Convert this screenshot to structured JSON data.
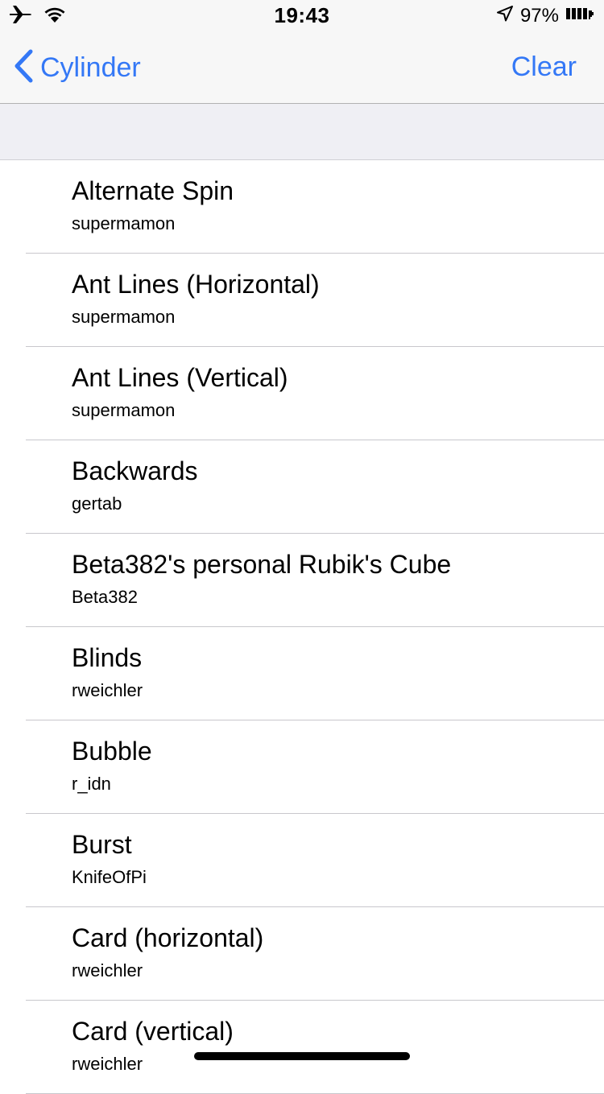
{
  "status_bar": {
    "time": "19:43",
    "battery_percent": "97%",
    "icons": [
      "airplane-icon",
      "wifi-icon",
      "location-arrow-icon",
      "battery-icon"
    ]
  },
  "nav": {
    "back_label": "Cylinder",
    "right_label": "Clear",
    "accent_color": "#3478f6"
  },
  "list": {
    "items": [
      {
        "title": "Alternate Spin",
        "author": "supermamon"
      },
      {
        "title": "Ant Lines (Horizontal)",
        "author": "supermamon"
      },
      {
        "title": "Ant Lines (Vertical)",
        "author": "supermamon"
      },
      {
        "title": "Backwards",
        "author": "gertab"
      },
      {
        "title": "Beta382's personal Rubik's Cube",
        "author": "Beta382"
      },
      {
        "title": "Blinds",
        "author": "rweichler"
      },
      {
        "title": "Bubble",
        "author": "r_idn"
      },
      {
        "title": "Burst",
        "author": "KnifeOfPi"
      },
      {
        "title": "Card (horizontal)",
        "author": "rweichler"
      },
      {
        "title": "Card (vertical)",
        "author": "rweichler"
      }
    ]
  }
}
